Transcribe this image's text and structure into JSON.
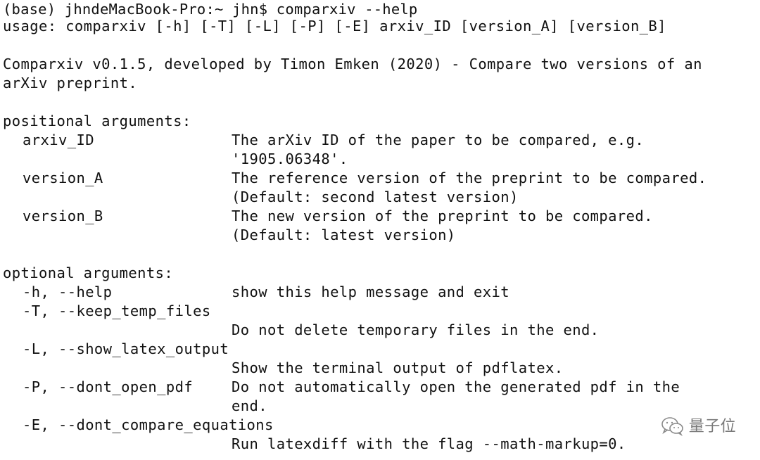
{
  "prompt": "(base) jhndeMacBook-Pro:~ jhn$ comparxiv --help",
  "usage": "usage: comparxiv [-h] [-T] [-L] [-P] [-E] arxiv_ID [version_A] [version_B]",
  "description": [
    "Comparxiv v0.1.5, developed by Timon Emken (2020) - Compare two versions of an",
    "arXiv preprint."
  ],
  "positional": {
    "header": "positional arguments:",
    "args": [
      {
        "name": "arxiv_ID",
        "desc": [
          "The arXiv ID of the paper to be compared, e.g.",
          "'1905.06348'."
        ]
      },
      {
        "name": "version_A",
        "desc": [
          "The reference version of the preprint to be compared.",
          "(Default: second latest version)"
        ]
      },
      {
        "name": "version_B",
        "desc": [
          "The new version of the preprint to be compared.",
          "(Default: latest version)"
        ]
      }
    ]
  },
  "optional": {
    "header": "optional arguments:",
    "args": [
      {
        "name": "-h, --help",
        "desc": [
          "show this help message and exit"
        ]
      },
      {
        "name": "-T, --keep_temp_files",
        "desc": [
          "Do not delete temporary files in the end."
        ]
      },
      {
        "name": "-L, --show_latex_output",
        "desc": [
          "Show the terminal output of pdflatex."
        ]
      },
      {
        "name": "-P, --dont_open_pdf",
        "desc": [
          "Do not automatically open the generated pdf in the",
          "end."
        ]
      },
      {
        "name": "-E, --dont_compare_equations",
        "desc": [
          "Run latexdiff with the flag --math-markup=0."
        ]
      }
    ]
  },
  "watermark": {
    "text": "量子位",
    "icon": "wechat-icon",
    "color": "#7a7a7a"
  }
}
